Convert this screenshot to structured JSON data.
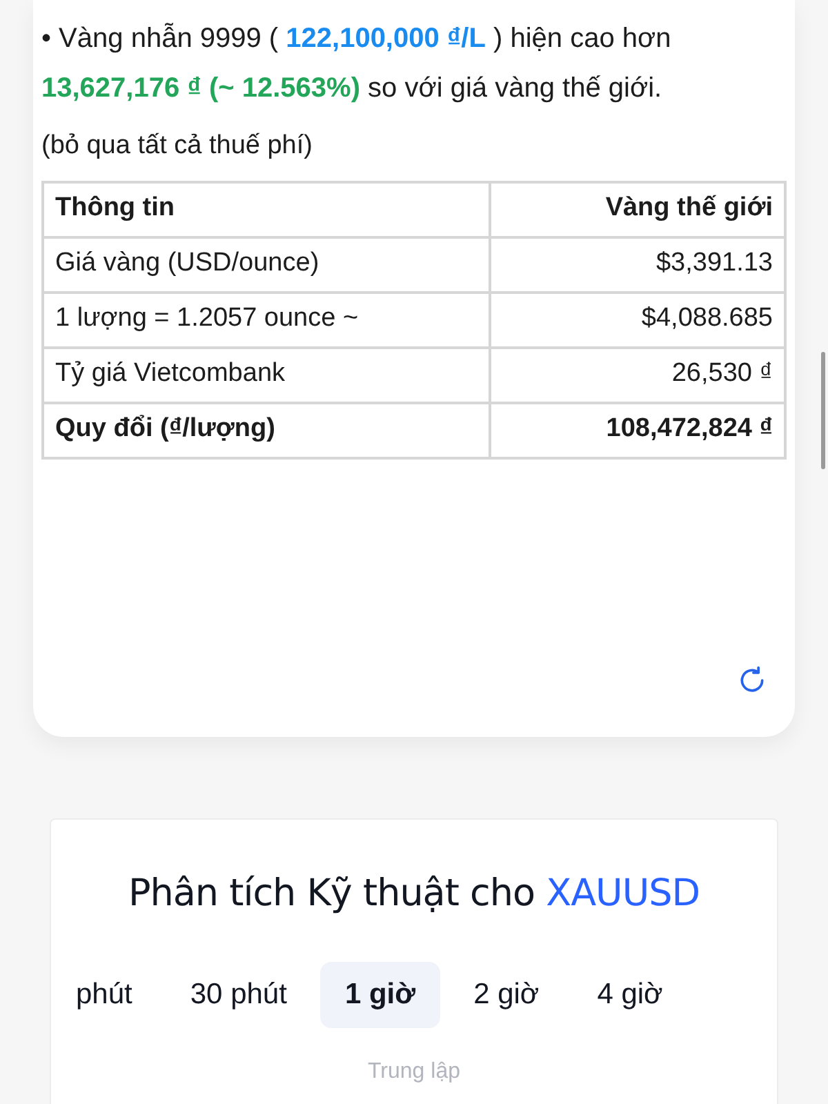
{
  "summary": {
    "segments": [
      {
        "kind": "plain",
        "text": "• Vàng nhẫn 9999 ( "
      },
      {
        "kind": "price",
        "text": "122,100,000 ₫/L"
      },
      {
        "kind": "plain",
        "text": " ) hiện cao hơn "
      },
      {
        "kind": "diff",
        "text": "13,627,176 ₫ (~ 12.563%)"
      },
      {
        "kind": "plain",
        "text": " so với giá vàng thế giới."
      }
    ],
    "note": "(bỏ qua tất cả thuế phí)"
  },
  "table": {
    "columns": [
      "Thông tin",
      "Vàng thế giới"
    ],
    "rows": [
      {
        "cells": [
          "Giá vàng (USD/ounce)",
          "$3,391.13"
        ],
        "bold": false
      },
      {
        "cells": [
          "1 lượng = 1.2057 ounce ~",
          "$4,088.685"
        ],
        "bold": false
      },
      {
        "cells": [
          "Tỷ giá Vietcombank",
          "26,530 ₫"
        ],
        "bold": false
      },
      {
        "cells": [
          "Quy đổi (₫/lượng)",
          "108,472,824 ₫"
        ],
        "bold": true
      }
    ]
  },
  "analysis": {
    "title": "Phân tích Kỹ thuật cho ",
    "symbol": "XAUUSD",
    "tabs": [
      {
        "label": "phút",
        "selected": false
      },
      {
        "label": "30 phút",
        "selected": false
      },
      {
        "label": "1 giờ",
        "selected": true
      },
      {
        "label": "2 giờ",
        "selected": false
      },
      {
        "label": "4 giờ",
        "selected": false
      }
    ],
    "verdict": "Trung lập"
  }
}
